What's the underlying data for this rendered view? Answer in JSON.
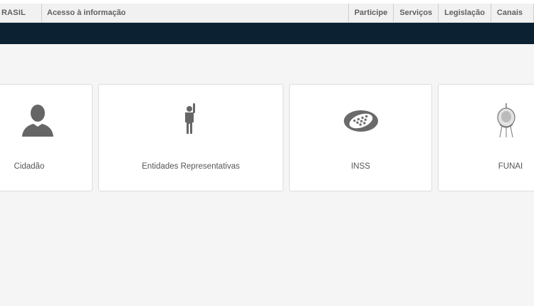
{
  "topbar": {
    "brand": "RASIL",
    "access_link": "Acesso à informação",
    "links": [
      "Participe",
      "Serviços",
      "Legislação",
      "Canais"
    ]
  },
  "cards": [
    {
      "label": "Cidadão",
      "icon": "person-icon"
    },
    {
      "label": "Entidades Representativas",
      "icon": "raised-hand-person-icon"
    },
    {
      "label": "INSS",
      "icon": "inss-logo-icon"
    },
    {
      "label": "FUNAI",
      "icon": "funai-logo-icon"
    }
  ],
  "colors": {
    "background": "#f5f5f5",
    "header_band": "#0c2233",
    "icon_gray": "#666666"
  }
}
